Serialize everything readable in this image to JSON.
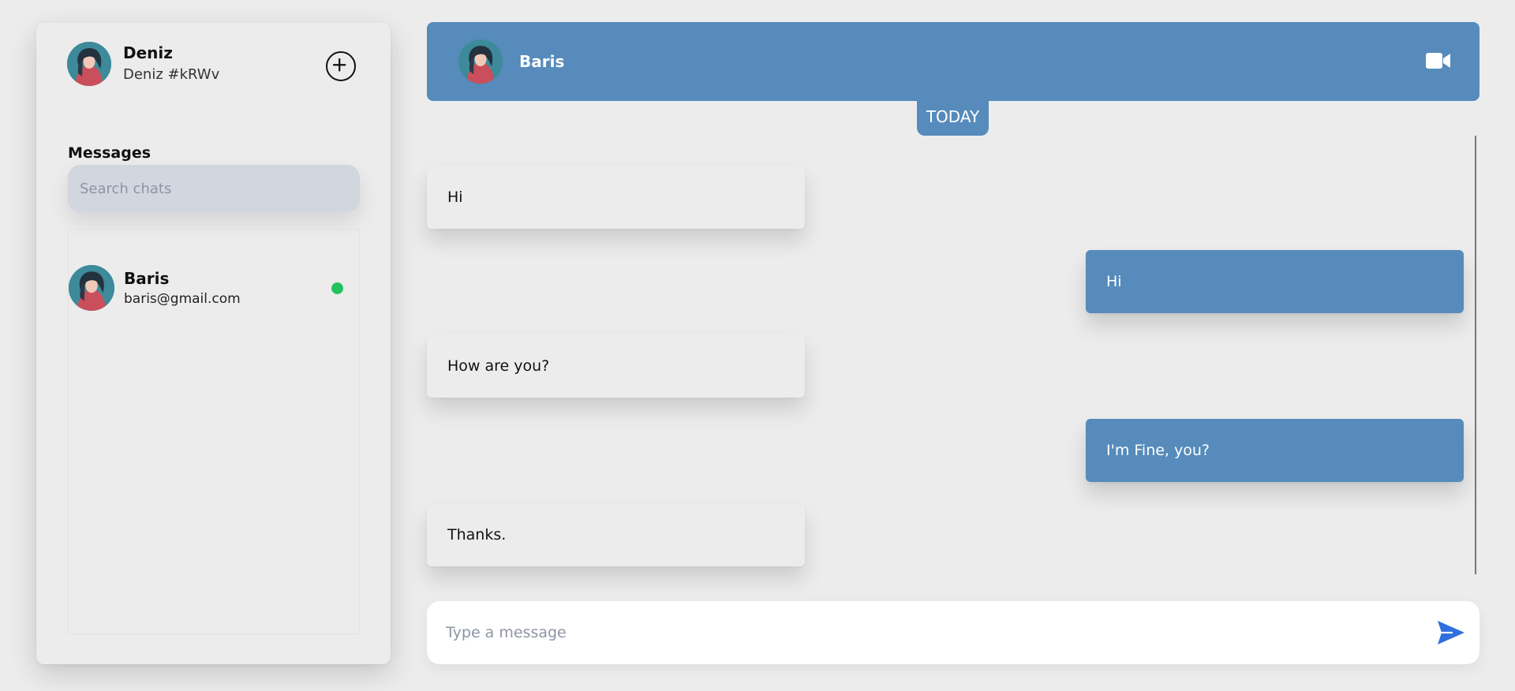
{
  "colors": {
    "accent": "#568bbb",
    "background": "#ececec",
    "online": "#22c35e",
    "send_icon": "#2f6fe0"
  },
  "profile": {
    "name": "Deniz",
    "tag": "Deniz #kRWv",
    "avatar_icon": "avatar-girl-illustration",
    "add_icon": "plus-circle-icon"
  },
  "sidebar": {
    "heading": "Messages",
    "search_placeholder": "Search chats",
    "chats": [
      {
        "name": "Baris",
        "email": "baris@gmail.com",
        "online": true
      }
    ]
  },
  "chat": {
    "contact_name": "Baris",
    "video_icon": "video-camera-icon",
    "day_label": "TODAY",
    "messages": [
      {
        "direction": "in",
        "text": "Hi"
      },
      {
        "direction": "out",
        "text": "Hi"
      },
      {
        "direction": "in",
        "text": "How are you?"
      },
      {
        "direction": "out",
        "text": "I'm Fine, you?"
      },
      {
        "direction": "in",
        "text": "Thanks."
      }
    ]
  },
  "composer": {
    "placeholder": "Type a message",
    "send_icon": "send-paper-plane-icon"
  }
}
